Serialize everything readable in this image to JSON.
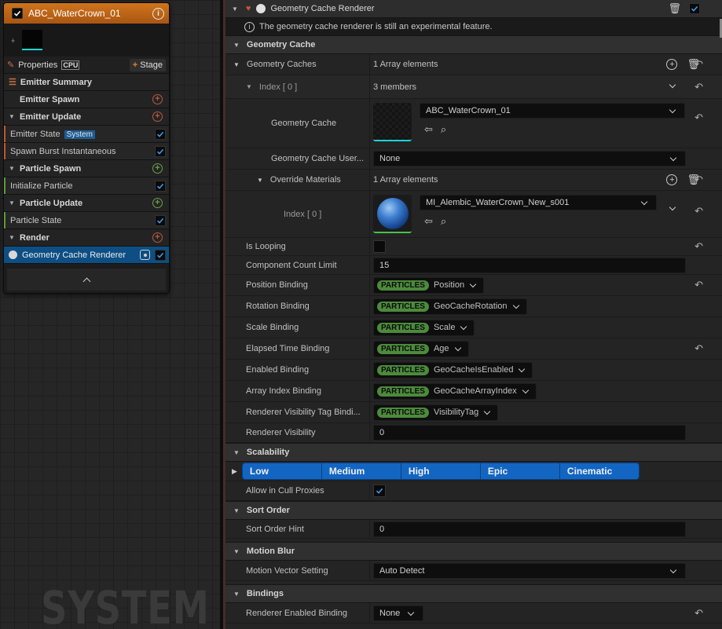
{
  "node": {
    "title": "ABC_WaterCrown_01",
    "properties_label": "Properties",
    "cpu_label": "CPU",
    "stage_label": "Stage",
    "emitter_summary": "Emitter Summary",
    "emitter_spawn": "Emitter Spawn",
    "emitter_update": "Emitter Update",
    "emitter_state": "Emitter State",
    "system_badge": "System",
    "spawn_burst": "Spawn Burst Instantaneous",
    "particle_spawn": "Particle Spawn",
    "initialize_particle": "Initialize Particle",
    "particle_update": "Particle Update",
    "particle_state": "Particle State",
    "render": "Render",
    "geometry_cache_renderer": "Geometry Cache Renderer"
  },
  "graph": {
    "watermark": "SYSTEM"
  },
  "details": {
    "title": "Geometry Cache Renderer",
    "info": "The geometry cache renderer is still an experimental feature.",
    "sec_geometry_cache": "Geometry Cache",
    "geometry_caches_label": "Geometry Caches",
    "geometry_caches_value": "1 Array elements",
    "index0_label": "Index [ 0 ]",
    "index0_value": "3 members",
    "geometry_cache_label": "Geometry Cache",
    "geometry_cache_value": "ABC_WaterCrown_01",
    "gc_user_label": "Geometry Cache User...",
    "gc_user_value": "None",
    "override_materials_label": "Override Materials",
    "override_materials_value": "1 Array elements",
    "om_index0_label": "Index [ 0 ]",
    "om_index0_value": "MI_Alembic_WaterCrown_New_s001",
    "is_looping_label": "Is Looping",
    "component_count_label": "Component Count Limit",
    "component_count_value": "15",
    "particles_tag": "PARTICLES",
    "bindings": [
      {
        "label": "Position Binding",
        "value": "Position"
      },
      {
        "label": "Rotation Binding",
        "value": "GeoCacheRotation"
      },
      {
        "label": "Scale Binding",
        "value": "Scale"
      },
      {
        "label": "Elapsed Time Binding",
        "value": "Age"
      },
      {
        "label": "Enabled Binding",
        "value": "GeoCacheIsEnabled"
      },
      {
        "label": "Array Index Binding",
        "value": "GeoCacheArrayIndex"
      },
      {
        "label": "Renderer Visibility Tag Bindi...",
        "value": "VisibilityTag"
      }
    ],
    "renderer_visibility_label": "Renderer Visibility",
    "renderer_visibility_value": "0",
    "sec_scalability": "Scalability",
    "scalability_levels": [
      "Low",
      "Medium",
      "High",
      "Epic",
      "Cinematic"
    ],
    "allow_cull_label": "Allow in Cull Proxies",
    "sec_sort_order": "Sort Order",
    "sort_order_hint_label": "Sort Order Hint",
    "sort_order_hint_value": "0",
    "sec_motion_blur": "Motion Blur",
    "motion_vector_label": "Motion Vector Setting",
    "motion_vector_value": "Auto Detect",
    "sec_bindings": "Bindings",
    "renderer_enabled_label": "Renderer Enabled Binding",
    "renderer_enabled_value": "None"
  },
  "colors": {
    "header_orange": "#c96b18",
    "accent_blue": "#1365c2",
    "particles_green": "#4c8a3c",
    "cyan": "#1ad6d6"
  },
  "icons": [
    "info-icon",
    "trash-icon",
    "reset-arrow-icon",
    "add-circle-icon",
    "browse-icon",
    "use-selected-icon",
    "chevron-down-icon"
  ]
}
